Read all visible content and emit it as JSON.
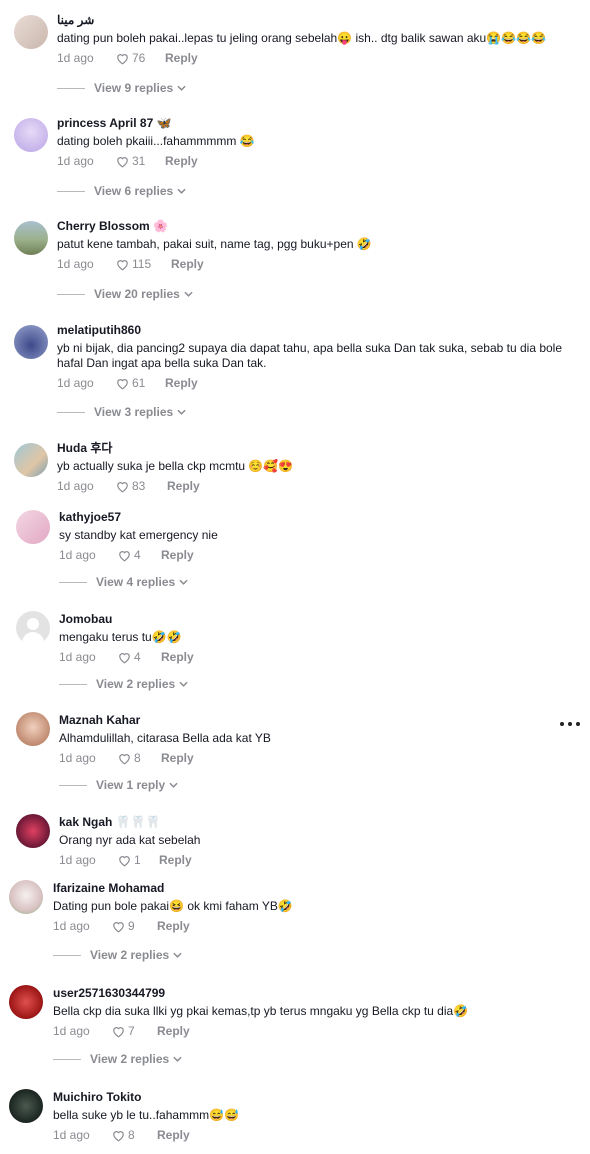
{
  "colors": {
    "secondary_text": "#8a8b91",
    "primary_text": "#161823"
  },
  "comments": [
    {
      "username": "شر مينا",
      "text": "dating pun boleh pakai..lepas tu jeling orang sebelah😛 ish.. dtg balik sawan aku😭😂😂😂",
      "time": "1d ago",
      "likes": "76",
      "reply": "Reply",
      "view_replies": "View 9 replies"
    },
    {
      "username": "princess April 87 🦋",
      "text": "dating boleh pkaiii...fahammmmm 😂",
      "time": "1d ago",
      "likes": "31",
      "reply": "Reply",
      "view_replies": "View 6 replies"
    },
    {
      "username": "Cherry Blossom 🌸",
      "text": "patut kene tambah, pakai suit, name tag, pgg buku+pen 🤣",
      "time": "1d ago",
      "likes": "115",
      "reply": "Reply",
      "view_replies": "View 20 replies"
    },
    {
      "username": "melatiputih860",
      "text": "yb ni bijak, dia pancing2 supaya dia dapat tahu, apa bella suka Dan tak suka, sebab tu dia bole hafal Dan ingat apa bella suka Dan tak.",
      "time": "1d ago",
      "likes": "61",
      "reply": "Reply",
      "view_replies": "View 3 replies"
    },
    {
      "username": "Huda 후다",
      "text": "yb actually suka je bella ckp mcmtu ☺️🥰😍",
      "time": "1d ago",
      "likes": "83",
      "reply": "Reply",
      "view_replies": ""
    },
    {
      "username": "kathyjoe57",
      "text": "sy standby kat emergency nie",
      "time": "1d ago",
      "likes": "4",
      "reply": "Reply",
      "view_replies": "View 4 replies"
    },
    {
      "username": "Jomobau",
      "text": "mengaku terus tu🤣🤣",
      "time": "1d ago",
      "likes": "4",
      "reply": "Reply",
      "view_replies": "View 2 replies"
    },
    {
      "username": "Maznah Kahar",
      "text": "Alhamdulillah, citarasa Bella ada kat YB",
      "time": "1d ago",
      "likes": "8",
      "reply": "Reply",
      "view_replies": "View 1 reply"
    },
    {
      "username": "kak Ngah 🦷🦷🦷",
      "text": "Orang nyr ada kat sebelah",
      "time": "1d ago",
      "likes": "1",
      "reply": "Reply",
      "view_replies": ""
    },
    {
      "username": "Ifarizaine Mohamad",
      "text": "Dating pun bole pakai😆 ok kmi faham YB🤣",
      "time": "1d ago",
      "likes": "9",
      "reply": "Reply",
      "view_replies": "View 2 replies"
    },
    {
      "username": "user2571630344799",
      "text": "Bella ckp dia suka llki yg pkai kemas,tp yb terus mngaku yg Bella ckp tu dia🤣",
      "time": "1d ago",
      "likes": "7",
      "reply": "Reply",
      "view_replies": "View 2 replies"
    },
    {
      "username": "Muichiro Tokito",
      "text": "bella suke yb le tu..fahammm😅😅",
      "time": "1d ago",
      "likes": "8",
      "reply": "Reply",
      "view_replies": ""
    }
  ]
}
